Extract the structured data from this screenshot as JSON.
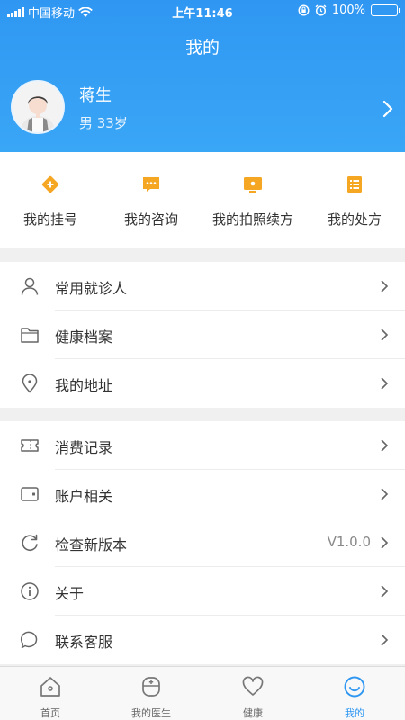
{
  "status_bar": {
    "carrier": "中国移动",
    "time": "上午11:46",
    "battery": "100%"
  },
  "header": {
    "title": "我的"
  },
  "profile": {
    "name": "蒋生",
    "info": "男 33岁"
  },
  "quick_actions": [
    {
      "label": "我的挂号",
      "icon": "registration-icon"
    },
    {
      "label": "我的咨询",
      "icon": "consultation-chat-icon"
    },
    {
      "label": "我的拍照续方",
      "icon": "photo-renewal-icon"
    },
    {
      "label": "我的处方",
      "icon": "prescription-list-icon"
    }
  ],
  "menu_group_1": [
    {
      "label": "常用就诊人",
      "icon": "person-icon"
    },
    {
      "label": "健康档案",
      "icon": "folder-icon"
    },
    {
      "label": "我的地址",
      "icon": "location-pin-icon"
    }
  ],
  "menu_group_2": [
    {
      "label": "消费记录",
      "icon": "ticket-icon"
    },
    {
      "label": "账户相关",
      "icon": "wallet-icon"
    },
    {
      "label": "检查新版本",
      "icon": "refresh-icon",
      "value": "V1.0.0"
    },
    {
      "label": "关于",
      "icon": "info-icon"
    },
    {
      "label": "联系客服",
      "icon": "chat-bubble-icon"
    }
  ],
  "tabbar": [
    {
      "label": "首页",
      "icon": "home-icon"
    },
    {
      "label": "我的医生",
      "icon": "doctor-icon"
    },
    {
      "label": "健康",
      "icon": "heart-icon"
    },
    {
      "label": "我的",
      "icon": "smiley-icon",
      "active": true
    }
  ],
  "colors": {
    "primary": "#2f97f2",
    "accent_orange": "#f5a623",
    "background": "#f0f0f0"
  }
}
